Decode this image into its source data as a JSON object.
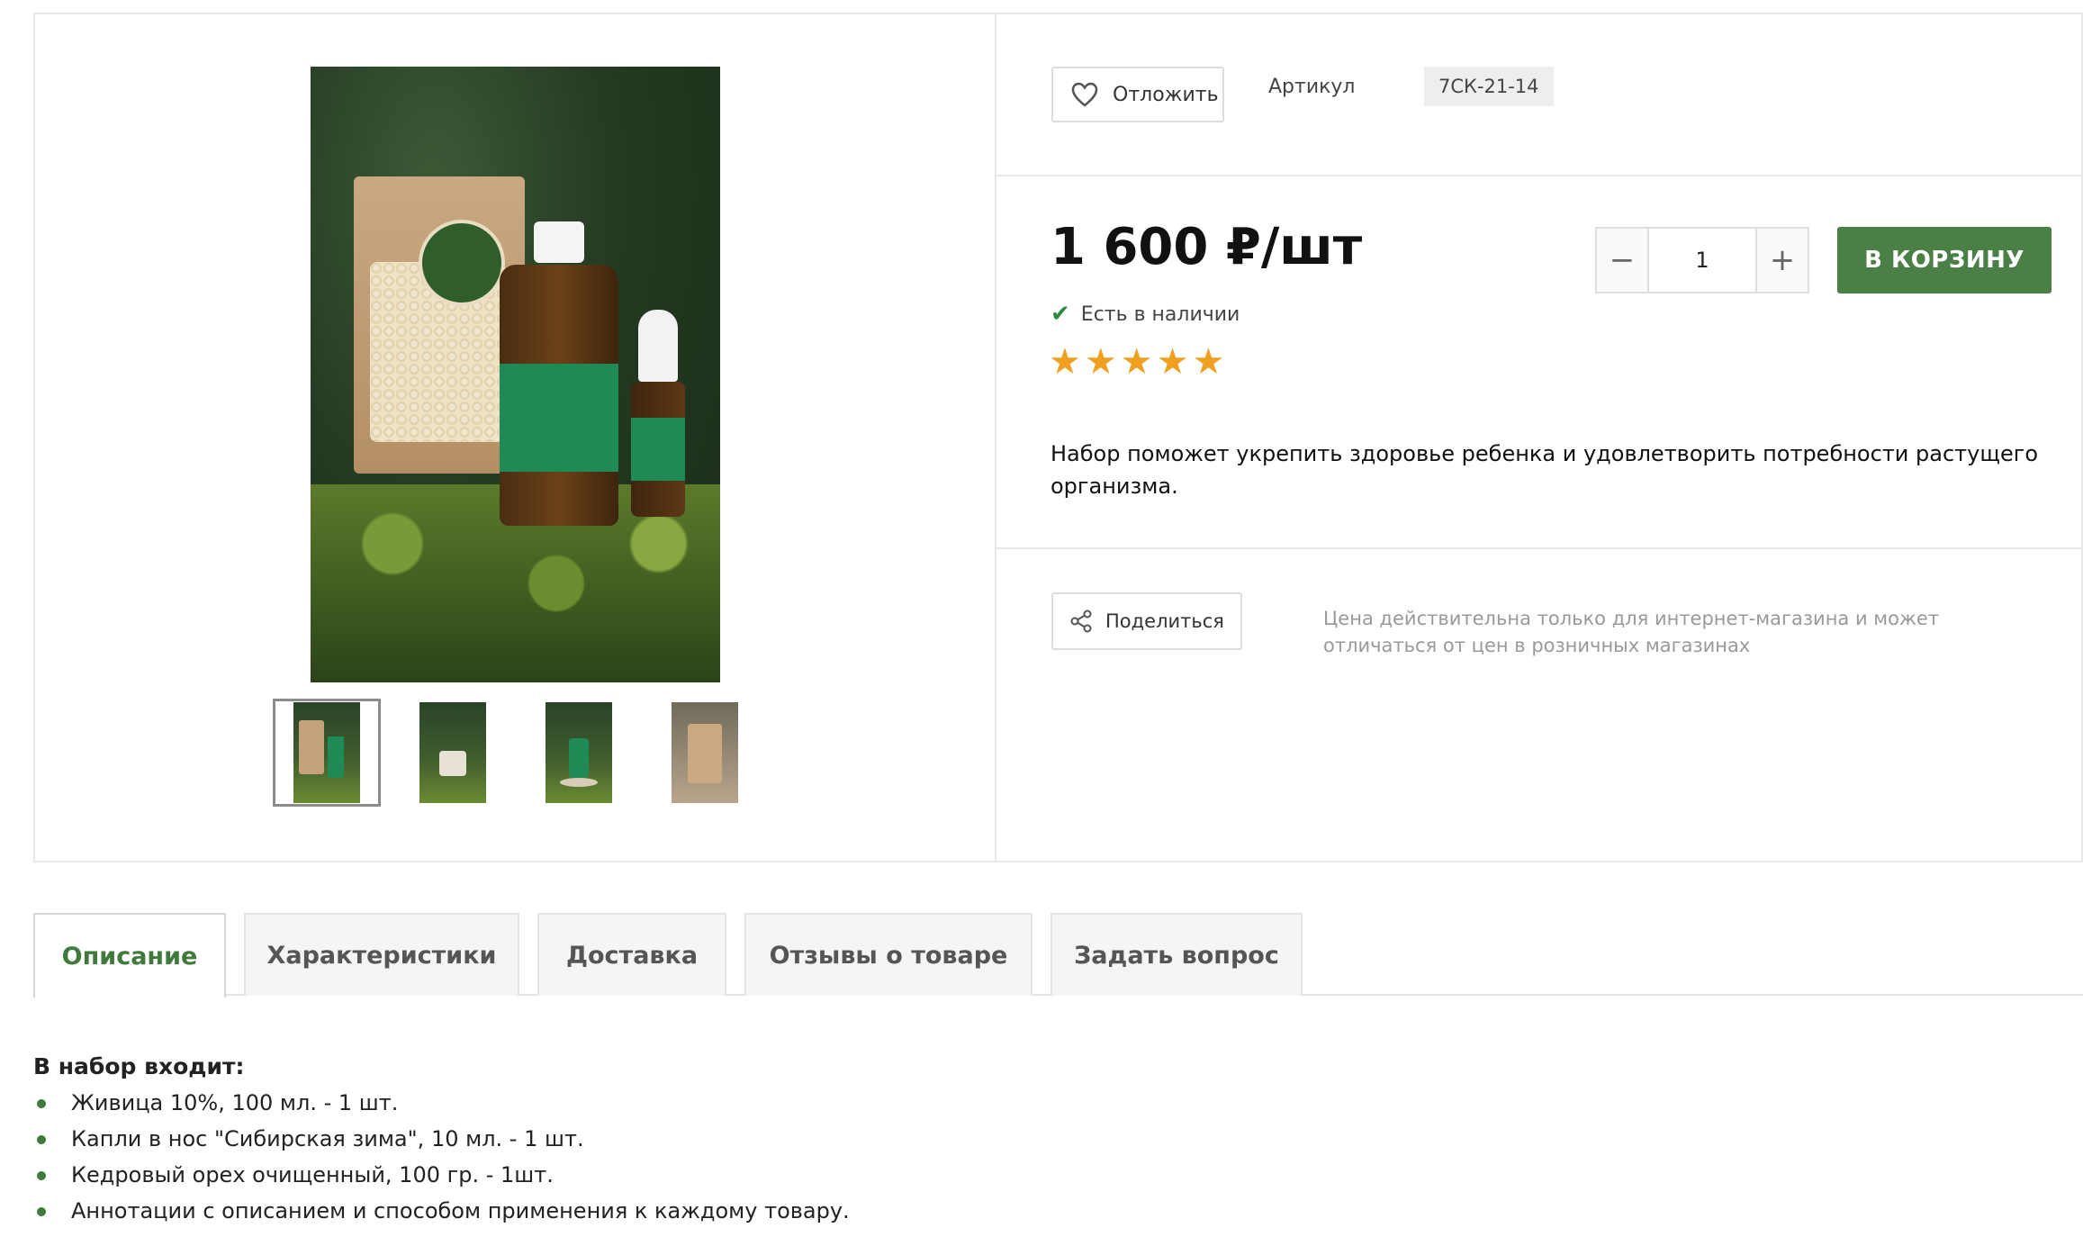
{
  "product": {
    "favorite_label": "Отложить",
    "sku_label": "Артикул",
    "sku_value": "7СК-21-14",
    "price": "1 600 ₽/шт",
    "stock": "Есть в наличии",
    "rating_stars": 5,
    "description": "Набор поможет укрепить здоровье ребенка и удовлетворить потребности растущего организма.",
    "quantity": "1",
    "add_to_cart": "В КОРЗИНУ",
    "share_label": "Поделиться",
    "price_note": "Цена действительна только для интернет-магазина и может отличаться от цен в розничных магазинах"
  },
  "gallery": {
    "thumbnail_count": 4,
    "active_thumbnail": 0
  },
  "tabs": [
    {
      "label": "Описание",
      "active": true
    },
    {
      "label": "Характеристики",
      "active": false
    },
    {
      "label": "Доставка",
      "active": false
    },
    {
      "label": "Отзывы о товаре",
      "active": false
    },
    {
      "label": "Задать вопрос",
      "active": false
    }
  ],
  "content": {
    "heading": "В набор входит:",
    "items": [
      "Живица 10%, 100 мл. - 1 шт.",
      "Капли в нос \"Сибирская зима\", 10 мл. - 1 шт.",
      "Кедровый орех очищенный, 100 гр. - 1шт.",
      "Аннотации с описанием и способом применения к каждому товару."
    ]
  },
  "colors": {
    "accent": "#4a8046",
    "active_tab_text": "#3f7a3b",
    "star": "#f0a020",
    "stock_check": "#2e8b3b"
  }
}
